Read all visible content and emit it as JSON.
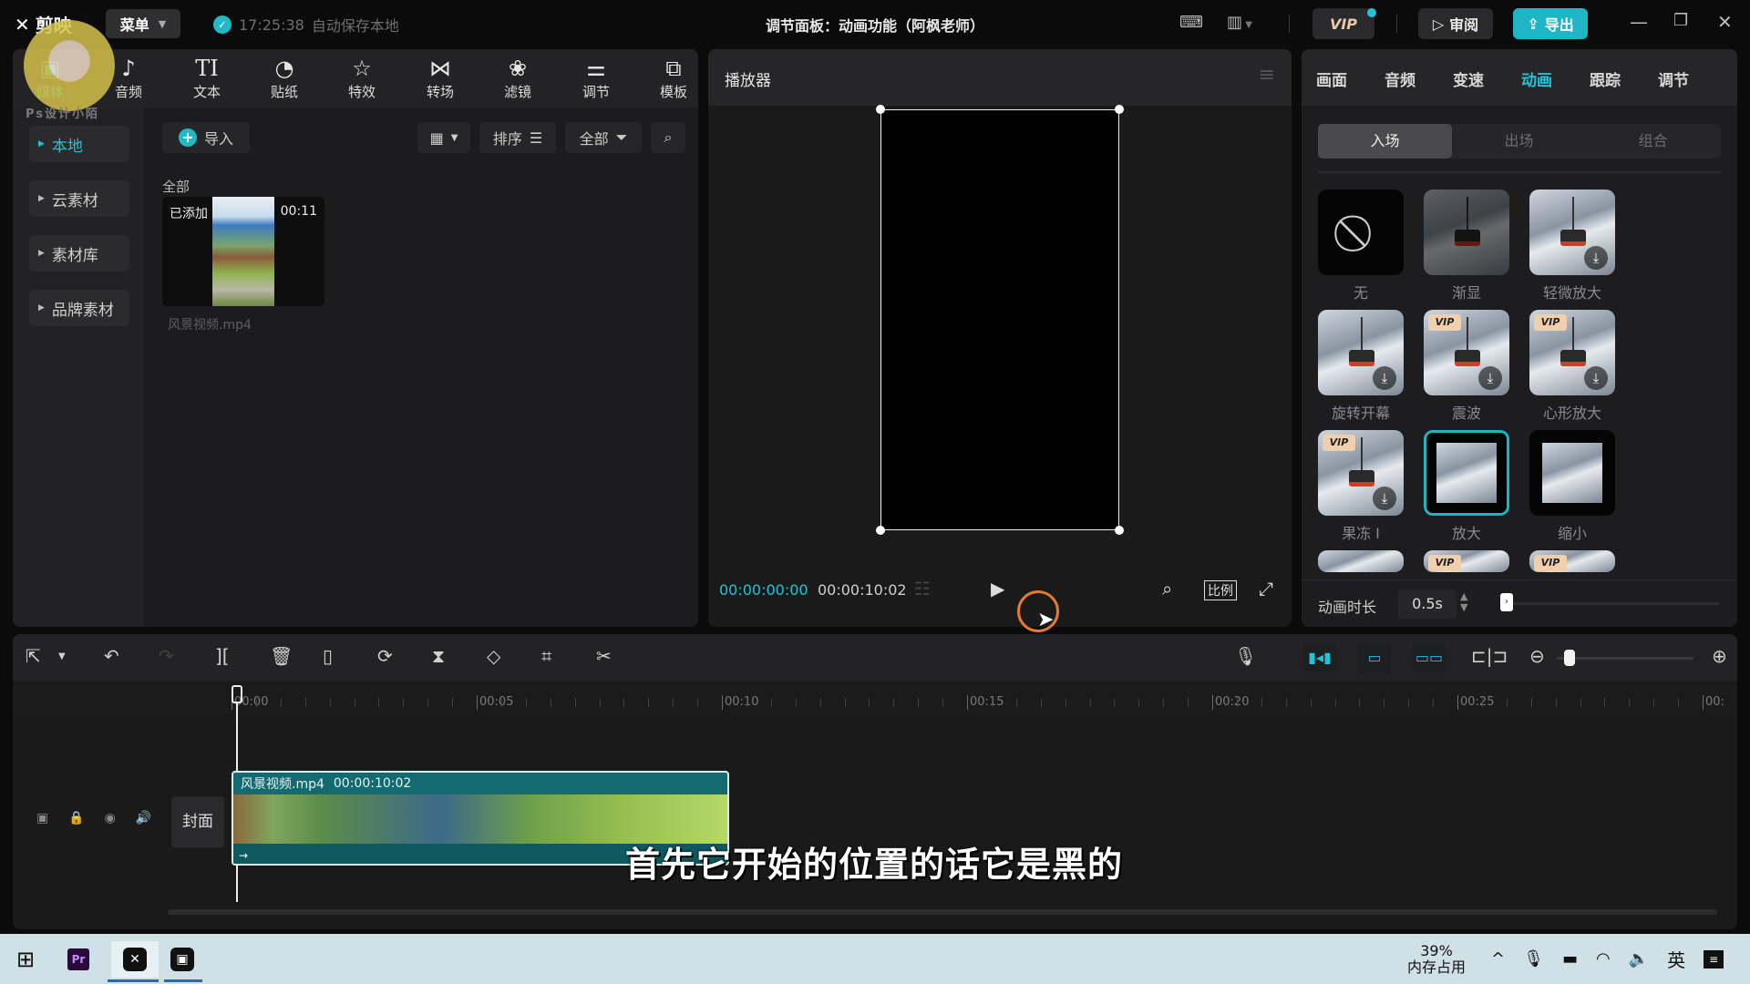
{
  "app": {
    "name": "剪映",
    "menu_label": "菜单",
    "autosave_time": "17:25:38",
    "autosave_text": "自动保存本地",
    "window_title": "调节面板：动画功能（阿枫老师）",
    "vip_label": "VIP",
    "review_label": "审阅",
    "export_label": "导出",
    "watermark_text": "Ps设计小陌"
  },
  "colors": {
    "accent": "#22c3d6",
    "export_bg": "#1eb5c6",
    "vip_tag": "#f0cfae",
    "record_ring": "#e47a32"
  },
  "media_toolbar": [
    {
      "label": "媒体",
      "icon": "media-icon",
      "active": true
    },
    {
      "label": "音频",
      "icon": "audio-icon"
    },
    {
      "label": "文本",
      "icon": "text-icon"
    },
    {
      "label": "贴纸",
      "icon": "sticker-icon"
    },
    {
      "label": "特效",
      "icon": "effects-icon"
    },
    {
      "label": "转场",
      "icon": "transition-icon"
    },
    {
      "label": "滤镜",
      "icon": "filter-icon"
    },
    {
      "label": "调节",
      "icon": "adjust-icon"
    },
    {
      "label": "模板",
      "icon": "template-icon"
    }
  ],
  "sidebar": {
    "items": [
      {
        "label": "本地",
        "active": true
      },
      {
        "label": "云素材"
      },
      {
        "label": "素材库"
      },
      {
        "label": "品牌素材"
      }
    ]
  },
  "media": {
    "import_label": "导入",
    "sort_label": "排序",
    "filter_label": "全部",
    "section_label": "全部",
    "items": [
      {
        "badge": "已添加",
        "duration": "00:11",
        "filename": "风景视频.mp4"
      }
    ]
  },
  "player": {
    "title": "播放器",
    "current_time": "00:00:00:00",
    "total_time": "00:00:10:02",
    "ratio_label": "比例"
  },
  "props": {
    "tabs": [
      {
        "label": "画面"
      },
      {
        "label": "音频"
      },
      {
        "label": "变速"
      },
      {
        "label": "动画",
        "active": true
      },
      {
        "label": "跟踪"
      },
      {
        "label": "调节"
      }
    ],
    "segments": [
      {
        "label": "入场",
        "active": true
      },
      {
        "label": "出场"
      },
      {
        "label": "组合"
      }
    ],
    "animations": [
      {
        "label": "无",
        "type": "none"
      },
      {
        "label": "渐显",
        "type": "dim"
      },
      {
        "label": "轻微放大",
        "download": true
      },
      {
        "label": "旋转开幕",
        "download": true
      },
      {
        "label": "震波",
        "vip": true,
        "download": true
      },
      {
        "label": "心形放大",
        "vip": true,
        "download": true
      },
      {
        "label": "果冻 I",
        "vip": true,
        "download": true
      },
      {
        "label": "放大",
        "selected": true,
        "type": "inset"
      },
      {
        "label": "缩小",
        "type": "inset"
      },
      {
        "label": "",
        "partial": true
      },
      {
        "label": "",
        "partial": true,
        "vip": true
      },
      {
        "label": "",
        "partial": true,
        "vip": true
      }
    ],
    "vip_tag": "VIP",
    "duration_label": "动画时长",
    "duration_value": "0.5s",
    "duration_slider_fraction": 0.0
  },
  "timeline": {
    "ruler_labels": [
      "00:00",
      "00:05",
      "00:10",
      "00:15",
      "00:20",
      "00:25",
      "00:"
    ],
    "cover_label": "封面",
    "clip": {
      "name": "风景视频.mp4",
      "duration": "00:00:10:02"
    },
    "zoom_fraction": 0.05
  },
  "subtitle": "首先它开始的位置的话它是黑的",
  "taskbar": {
    "memory_percent": "39%",
    "memory_label": "内存占用",
    "ime_label": "英"
  }
}
